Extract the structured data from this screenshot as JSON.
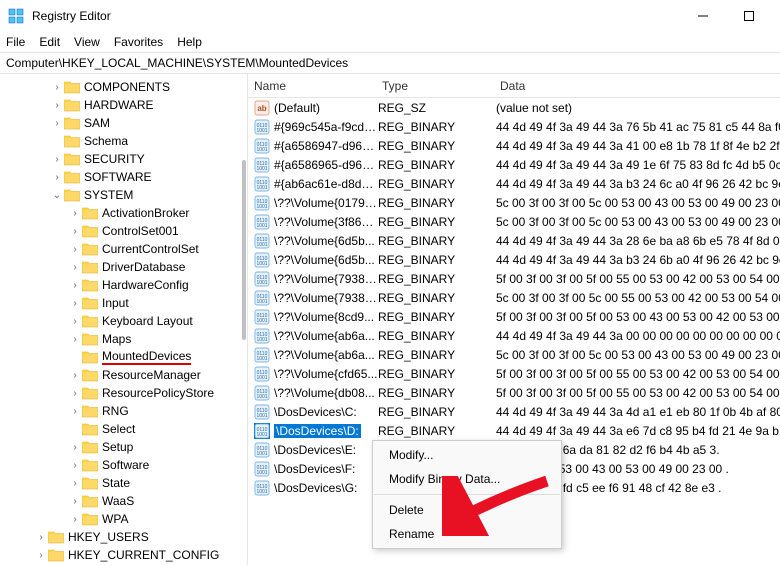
{
  "titlebar": {
    "title": "Registry Editor"
  },
  "menubar": {
    "file": "File",
    "edit": "Edit",
    "view": "View",
    "favorites": "Favorites",
    "help": "Help"
  },
  "address": "Computer\\HKEY_LOCAL_MACHINE\\SYSTEM\\MountedDevices",
  "tree": [
    {
      "indent": 48,
      "exp": ">",
      "label": "COMPONENTS"
    },
    {
      "indent": 48,
      "exp": ">",
      "label": "HARDWARE"
    },
    {
      "indent": 48,
      "exp": ">",
      "label": "SAM"
    },
    {
      "indent": 48,
      "exp": "",
      "label": "Schema"
    },
    {
      "indent": 48,
      "exp": ">",
      "label": "SECURITY"
    },
    {
      "indent": 48,
      "exp": ">",
      "label": "SOFTWARE"
    },
    {
      "indent": 48,
      "exp": "v",
      "label": "SYSTEM"
    },
    {
      "indent": 66,
      "exp": ">",
      "label": "ActivationBroker"
    },
    {
      "indent": 66,
      "exp": ">",
      "label": "ControlSet001"
    },
    {
      "indent": 66,
      "exp": ">",
      "label": "CurrentControlSet"
    },
    {
      "indent": 66,
      "exp": ">",
      "label": "DriverDatabase"
    },
    {
      "indent": 66,
      "exp": ">",
      "label": "HardwareConfig"
    },
    {
      "indent": 66,
      "exp": ">",
      "label": "Input"
    },
    {
      "indent": 66,
      "exp": ">",
      "label": "Keyboard Layout"
    },
    {
      "indent": 66,
      "exp": ">",
      "label": "Maps"
    },
    {
      "indent": 66,
      "exp": "",
      "label": "MountedDevices",
      "underlined": true
    },
    {
      "indent": 66,
      "exp": ">",
      "label": "ResourceManager"
    },
    {
      "indent": 66,
      "exp": ">",
      "label": "ResourcePolicyStore"
    },
    {
      "indent": 66,
      "exp": ">",
      "label": "RNG"
    },
    {
      "indent": 66,
      "exp": "",
      "label": "Select"
    },
    {
      "indent": 66,
      "exp": ">",
      "label": "Setup"
    },
    {
      "indent": 66,
      "exp": ">",
      "label": "Software"
    },
    {
      "indent": 66,
      "exp": ">",
      "label": "State"
    },
    {
      "indent": 66,
      "exp": ">",
      "label": "WaaS"
    },
    {
      "indent": 66,
      "exp": ">",
      "label": "WPA"
    },
    {
      "indent": 32,
      "exp": ">",
      "label": "HKEY_USERS"
    },
    {
      "indent": 32,
      "exp": ">",
      "label": "HKEY_CURRENT_CONFIG"
    }
  ],
  "columns": {
    "name": "Name",
    "type": "Type",
    "data": "Data"
  },
  "rows": [
    {
      "icon": "str",
      "name": "(Default)",
      "type": "REG_SZ",
      "data": "(value not set)"
    },
    {
      "icon": "bin",
      "name": "#{969c545a-f9cd-...",
      "type": "REG_BINARY",
      "data": "44 4d 49 4f 3a 49 44 3a 76 5b 41 ac 75 81 c5 44 8a f0."
    },
    {
      "icon": "bin",
      "name": "#{a6586947-d96e-...",
      "type": "REG_BINARY",
      "data": "44 4d 49 4f 3a 49 44 3a 41 00 e8 1b 78 1f 8f 4e b2 2f ."
    },
    {
      "icon": "bin",
      "name": "#{a6586965-d96e-...",
      "type": "REG_BINARY",
      "data": "44 4d 49 4f 3a 49 44 3a 49 1e 6f 75 83 8d fc 4d b5 0c."
    },
    {
      "icon": "bin",
      "name": "#{ab6ac61e-d8d8...",
      "type": "REG_BINARY",
      "data": "44 4d 49 4f 3a 49 44 3a b3 24 6c a0 4f 96 26 42 bc 9e."
    },
    {
      "icon": "bin",
      "name": "\\??\\Volume{0179a...",
      "type": "REG_BINARY",
      "data": "5c 00 3f 00 3f 00 5c 00 53 00 43 00 53 00 49 00 23 00 ."
    },
    {
      "icon": "bin",
      "name": "\\??\\Volume{3f86d...",
      "type": "REG_BINARY",
      "data": "5c 00 3f 00 3f 00 5c 00 53 00 43 00 53 00 49 00 23 00 ."
    },
    {
      "icon": "bin",
      "name": "\\??\\Volume{6d5b...",
      "type": "REG_BINARY",
      "data": "44 4d 49 4f 3a 49 44 3a 28 6e ba a8 6b e5 78 4f 8d 07."
    },
    {
      "icon": "bin",
      "name": "\\??\\Volume{6d5b...",
      "type": "REG_BINARY",
      "data": "44 4d 49 4f 3a 49 44 3a b3 24 6b a0 4f 96 26 42 bc 9e."
    },
    {
      "icon": "bin",
      "name": "\\??\\Volume{7938f...",
      "type": "REG_BINARY",
      "data": "5f 00 3f 00 3f 00 5f 00 55 00 53 00 42 00 53 00 54 00 ."
    },
    {
      "icon": "bin",
      "name": "\\??\\Volume{7938f...",
      "type": "REG_BINARY",
      "data": "5c 00 3f 00 3f 00 5c 00 55 00 53 00 42 00 53 00 54 00 ."
    },
    {
      "icon": "bin",
      "name": "\\??\\Volume{8cd9...",
      "type": "REG_BINARY",
      "data": "5f 00 3f 00 3f 00 5f 00 53 00 43 00 53 00 42 00 53 00 ."
    },
    {
      "icon": "bin",
      "name": "\\??\\Volume{ab6a...",
      "type": "REG_BINARY",
      "data": "44 4d 49 4f 3a 49 44 3a 00 00 00 00 00 00 00 00 00 00 ."
    },
    {
      "icon": "bin",
      "name": "\\??\\Volume{ab6a...",
      "type": "REG_BINARY",
      "data": "5c 00 3f 00 3f 00 5c 00 53 00 43 00 53 00 49 00 23 00 ."
    },
    {
      "icon": "bin",
      "name": "\\??\\Volume{cfd65...",
      "type": "REG_BINARY",
      "data": "5f 00 3f 00 3f 00 5f 00 55 00 53 00 42 00 53 00 54 00 ."
    },
    {
      "icon": "bin",
      "name": "\\??\\Volume{db08...",
      "type": "REG_BINARY",
      "data": "5f 00 3f 00 3f 00 5f 00 55 00 53 00 42 00 53 00 54 00 ."
    },
    {
      "icon": "bin",
      "name": "\\DosDevices\\C:",
      "type": "REG_BINARY",
      "data": "44 4d 49 4f 3a 49 44 3a 4d a1 e1 eb 80 1f 0b 4b af 80."
    },
    {
      "icon": "bin",
      "name": "\\DosDevices\\D:",
      "type": "REG_BINARY",
      "data": "44 4d 49 4f 3a 49 44 3a e6 7d c8 95 b4 fd 21 4e 9a b.",
      "selected": true
    },
    {
      "icon": "bin",
      "name": "\\DosDevices\\E:",
      "type": "",
      "data": "3a 49 44 3a 6a da 81 82 d2 f6 b4 4b a5 3."
    },
    {
      "icon": "bin",
      "name": "\\DosDevices\\F:",
      "type": "",
      "data": "3f 00 5c 00 53 00 43 00 53 00 49 00 23 00 ."
    },
    {
      "icon": "bin",
      "name": "\\DosDevices\\G:",
      "type": "",
      "data": "3a 49 44 3a fd c5 ee f6 91 48 cf 42 8e e3 ."
    }
  ],
  "contextMenu": {
    "modify": "Modify...",
    "modifyBinary": "Modify Binary Data...",
    "delete": "Delete",
    "rename": "Rename"
  }
}
